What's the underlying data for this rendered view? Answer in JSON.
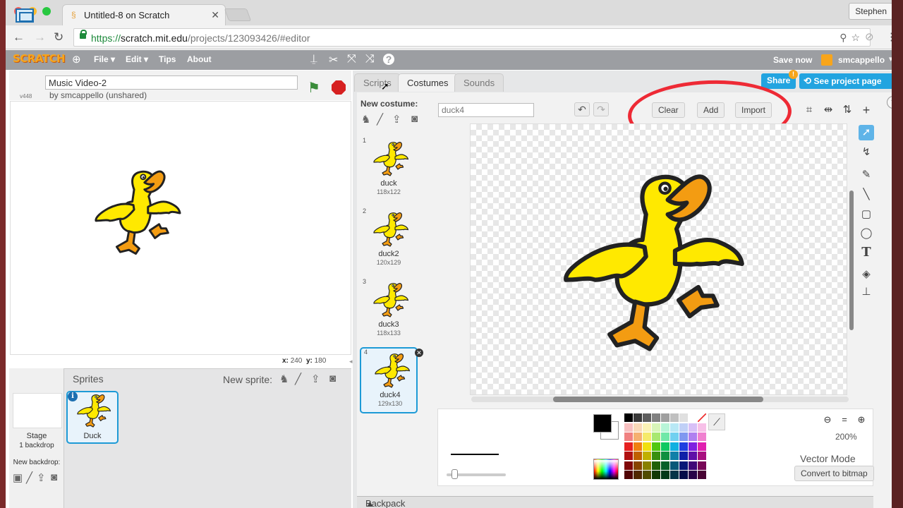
{
  "browser": {
    "tab_title": "Untitled-8 on Scratch",
    "profile": "Stephen",
    "url_scheme": "https://",
    "url_host": "scratch.mit.edu",
    "url_path": "/projects/123093426/#editor"
  },
  "menubar": {
    "logo": "SCRATCH",
    "file": "File ▾",
    "edit": "Edit ▾",
    "tips": "Tips",
    "about": "About",
    "save_now": "Save now",
    "username": "smcappello"
  },
  "stage": {
    "version": "v448",
    "project_title": "Music Video-2",
    "byline": "by smcappello (unshared)",
    "x_label": "x:",
    "x_value": "240",
    "y_label": "y:",
    "y_value": "180"
  },
  "sprites": {
    "header": "Sprites",
    "new_sprite": "New sprite:",
    "stage_label": "Stage",
    "stage_backdrops": "1 backdrop",
    "new_backdrop": "New backdrop:",
    "items": [
      {
        "name": "Duck"
      }
    ]
  },
  "editor": {
    "tabs": [
      "Scripts",
      "Costumes",
      "Sounds"
    ],
    "active_tab": "Costumes",
    "share": "Share",
    "see_project_page": "See project page",
    "new_costume": "New costume:",
    "costume_name": "duck4",
    "clear": "Clear",
    "add": "Add",
    "import": "Import",
    "zoom": "200%",
    "mode": "Vector Mode",
    "convert": "Convert to bitmap",
    "backpack": "Backpack",
    "costumes": [
      {
        "num": "1",
        "name": "duck",
        "size": "118x122"
      },
      {
        "num": "2",
        "name": "duck2",
        "size": "120x129"
      },
      {
        "num": "3",
        "name": "duck3",
        "size": "118x133"
      },
      {
        "num": "4",
        "name": "duck4",
        "size": "129x130"
      }
    ]
  },
  "palette_colors": [
    "#000000",
    "#3a3a3a",
    "#5e5e5e",
    "#808080",
    "#a0a0a0",
    "#c0c0c0",
    "#e0e0e0",
    "#ffffff",
    "none",
    "#f7c0c0",
    "#f9d9b8",
    "#fbf3b5",
    "#d8f5b8",
    "#b8f5d8",
    "#b8e8f5",
    "#c0d0f7",
    "#d8c0f7",
    "#f7c0e8",
    "#f08080",
    "#f5b070",
    "#f5ea6a",
    "#a8e870",
    "#70e8a8",
    "#70d0f0",
    "#8098f0",
    "#b080f0",
    "#f080d0",
    "#e62020",
    "#f08010",
    "#f0e010",
    "#50c810",
    "#10c860",
    "#10b0e0",
    "#2040e0",
    "#8020e0",
    "#e020b0",
    "#b01010",
    "#c06000",
    "#c0b000",
    "#389010",
    "#109040",
    "#1080a8",
    "#1020a8",
    "#6010a8",
    "#a81080",
    "#800808",
    "#884400",
    "#888000",
    "#206008",
    "#086028",
    "#085878",
    "#081878",
    "#400878",
    "#780858",
    "#500404",
    "#502800",
    "#504c00",
    "#123804",
    "#043818",
    "#043448",
    "#040c48",
    "#280448",
    "#480434"
  ],
  "annotation_color": "#ee2a35"
}
